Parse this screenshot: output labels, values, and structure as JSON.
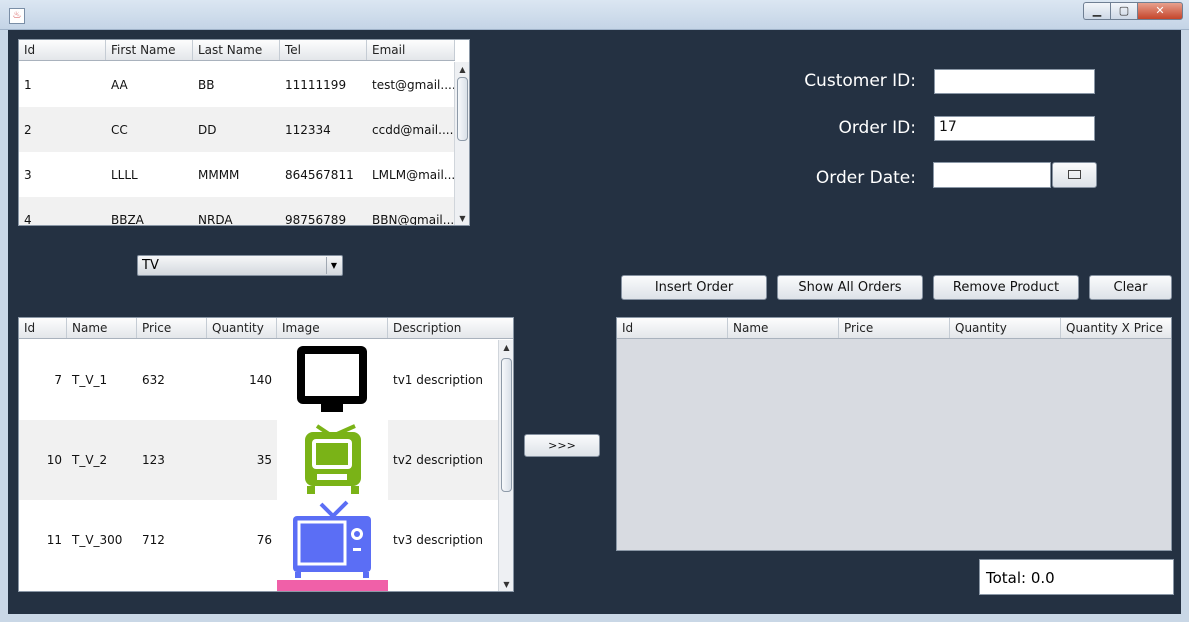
{
  "window": {
    "min_label": "▁",
    "max_label": "▢",
    "close_label": "✕"
  },
  "customers": {
    "columns": [
      "Id",
      "First Name",
      "Last Name",
      "Tel",
      "Email"
    ],
    "rows": [
      [
        "1",
        "AA",
        "BB",
        "11111199",
        "test@gmail...."
      ],
      [
        "2",
        "CC",
        "DD",
        "112334",
        "ccdd@mail...."
      ],
      [
        "3",
        "LLLL",
        "MMMM",
        "864567811",
        "LMLM@mail...."
      ],
      [
        "4",
        "BBZA",
        "NRDA",
        "98756789",
        "BBN@gmail...."
      ]
    ]
  },
  "category_select": {
    "value": "TV"
  },
  "form": {
    "customer_id_label": "Customer ID:",
    "customer_id_value": "",
    "order_id_label": "Order ID:",
    "order_id_value": "17",
    "order_date_label": "Order Date:",
    "order_date_value": ""
  },
  "buttons": {
    "insert_order": "Insert Order",
    "show_all_orders": "Show All Orders",
    "remove_product": "Remove Product",
    "clear": "Clear",
    "move": ">>>"
  },
  "products": {
    "columns": [
      "Id",
      "Name",
      "Price",
      "Quantity",
      "Image",
      "Description"
    ],
    "rows": [
      {
        "id": "7",
        "name": "T_V_1",
        "price": "632",
        "quantity": "140",
        "image": "monitor-tv-icon",
        "description": "tv1 description"
      },
      {
        "id": "10",
        "name": "T_V_2",
        "price": "123",
        "quantity": "35",
        "image": "retro-tv-icon",
        "description": "tv2 description"
      },
      {
        "id": "11",
        "name": "T_V_300",
        "price": "712",
        "quantity": "76",
        "image": "blue-tv-icon",
        "description": "tv3 description"
      }
    ]
  },
  "order_items": {
    "columns": [
      "Id",
      "Name",
      "Price",
      "Quantity",
      "Quantity X Price"
    ],
    "rows": []
  },
  "total": {
    "text": "Total: 0.0"
  },
  "colors": {
    "background": "#243142",
    "retro_tv": "#7ab317",
    "blue_tv": "#5b6ef5",
    "pink_stand": "#f060a8"
  }
}
